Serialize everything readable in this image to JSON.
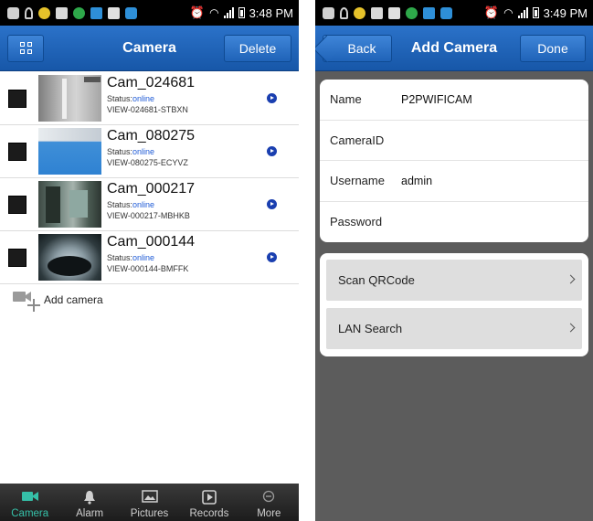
{
  "left_screen": {
    "status_time": "3:48 PM",
    "header": {
      "title": "Camera",
      "delete_label": "Delete"
    },
    "cameras": [
      {
        "name": "Cam_024681",
        "status_label": "Status:",
        "status": "online",
        "id": "VIEW-024681-STBXN"
      },
      {
        "name": "Cam_080275",
        "status_label": "Status:",
        "status": "online",
        "id": "VIEW-080275-ECYVZ"
      },
      {
        "name": "Cam_000217",
        "status_label": "Status:",
        "status": "online",
        "id": "VIEW-000217-MBHKB"
      },
      {
        "name": "Cam_000144",
        "status_label": "Status:",
        "status": "online",
        "id": "VIEW-000144-BMFFK"
      }
    ],
    "add_camera_label": "Add camera",
    "tabs": [
      {
        "label": "Camera",
        "icon": "video-camera-icon",
        "active": true
      },
      {
        "label": "Alarm",
        "icon": "bell-icon",
        "active": false
      },
      {
        "label": "Pictures",
        "icon": "picture-icon",
        "active": false
      },
      {
        "label": "Records",
        "icon": "play-icon",
        "active": false
      },
      {
        "label": "More",
        "icon": "more-icon",
        "active": false
      }
    ]
  },
  "right_screen": {
    "status_time": "3:49 PM",
    "header": {
      "title": "Add Camera",
      "back_label": "Back",
      "done_label": "Done"
    },
    "fields": [
      {
        "label": "Name",
        "value": "P2PWIFICAM"
      },
      {
        "label": "CameraID",
        "value": ""
      },
      {
        "label": "Username",
        "value": "admin"
      },
      {
        "label": "Password",
        "value": ""
      }
    ],
    "actions": [
      {
        "label": "Scan QRCode"
      },
      {
        "label": "LAN Search"
      }
    ]
  },
  "colors": {
    "navbar_blue": "#1f63b8",
    "online_blue": "#1f5bd6",
    "active_tab": "#35c0a8",
    "form_background": "#5c5c5c"
  }
}
